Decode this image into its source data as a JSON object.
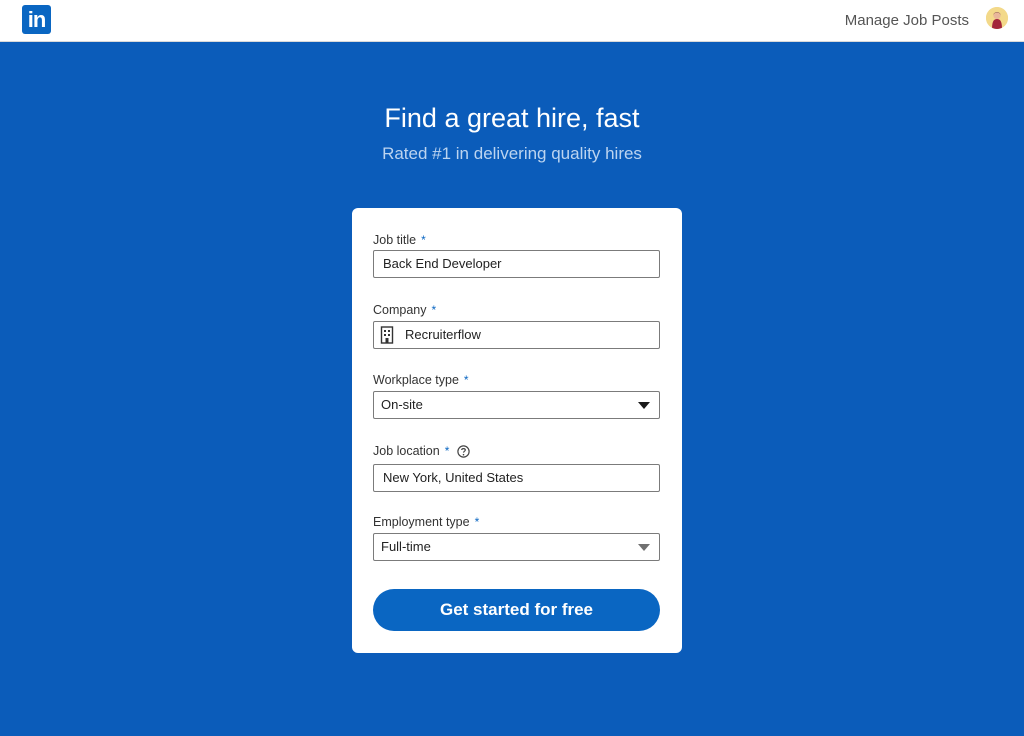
{
  "header": {
    "logo_text": "in",
    "manage_link": "Manage Job Posts"
  },
  "hero": {
    "title": "Find a great hire, fast",
    "subtitle": "Rated #1 in delivering quality hires"
  },
  "form": {
    "job_title": {
      "label": "Job title",
      "required_mark": "*",
      "value": "Back End Developer"
    },
    "company": {
      "label": "Company",
      "required_mark": "*",
      "value": "Recruiterflow"
    },
    "workplace_type": {
      "label": "Workplace type",
      "required_mark": "*",
      "value": "On-site"
    },
    "job_location": {
      "label": "Job location",
      "required_mark": "*",
      "value": "New York, United States"
    },
    "employment_type": {
      "label": "Employment type",
      "required_mark": "*",
      "value": "Full-time"
    },
    "submit_label": "Get started for free"
  },
  "icons": {
    "logo": "linkedin-logo-icon",
    "avatar": "user-avatar",
    "company": "building-icon",
    "help": "question-circle-icon",
    "dropdown": "caret-down-icon"
  },
  "colors": {
    "background": "#0b5cba",
    "brand": "#0a66c2",
    "card": "#ffffff"
  }
}
